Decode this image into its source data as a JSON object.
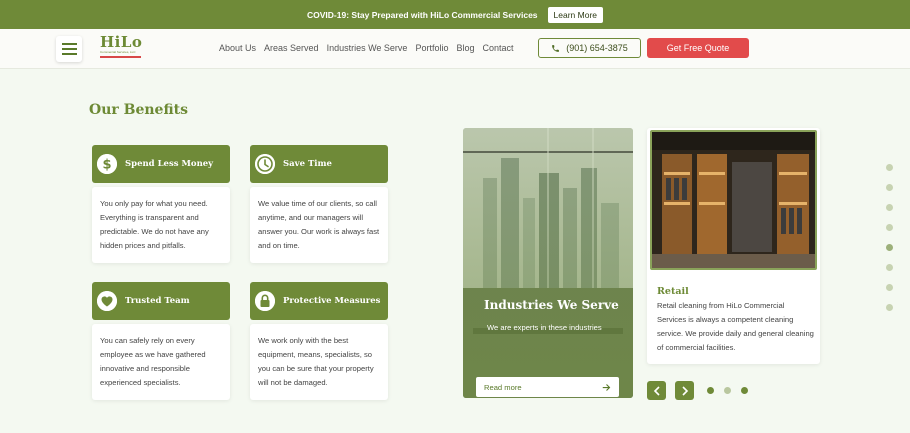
{
  "topbar": {
    "message": "COVID-19: Stay Prepared with HiLo Commercial Services",
    "button": "Learn More"
  },
  "logo": {
    "name": "HiLo",
    "sub": "Commercial Services, LLC"
  },
  "nav": [
    "About Us",
    "Areas Served",
    "Industries We Serve",
    "Portfolio",
    "Blog",
    "Contact"
  ],
  "phone": "(901) 654-3875",
  "quote_button": "Get Free Quote",
  "benefits": {
    "title": "Our Benefits",
    "cards": [
      {
        "icon": "dollar-icon",
        "title": "Spend Less Money",
        "text": "You only pay for what you need. Everything is transparent and predictable. We do not have any hidden prices and pitfalls."
      },
      {
        "icon": "clock-icon",
        "title": "Save Time",
        "text": "We value time of our clients, so call anytime, and our managers will answer you. Our work is always fast and on time."
      },
      {
        "icon": "heart-icon",
        "title": "Trusted Team",
        "text": "You can safely rely on every employee as we have gathered innovative and responsible experienced specialists."
      },
      {
        "icon": "lock-icon",
        "title": "Protective Measures",
        "text": "We work only with the best equipment, means, specialists, so you can be sure that your property will not be damaged."
      }
    ]
  },
  "slides": {
    "first": {
      "title": "Industries We Serve",
      "desc": "We are experts in these industries",
      "read_more": "Read more"
    },
    "second": {
      "title": "Retail",
      "desc": "Retail cleaning from HiLo Commercial Services is always a competent cleaning service. We provide daily and general cleaning of commercial facilities."
    }
  },
  "slider": {
    "dot_count": 3,
    "active_dot": 0
  },
  "side_dots": {
    "count": 8,
    "active": 4
  },
  "colors": {
    "brand_green": "#6f8a38",
    "accent_red": "#e24b4b"
  }
}
